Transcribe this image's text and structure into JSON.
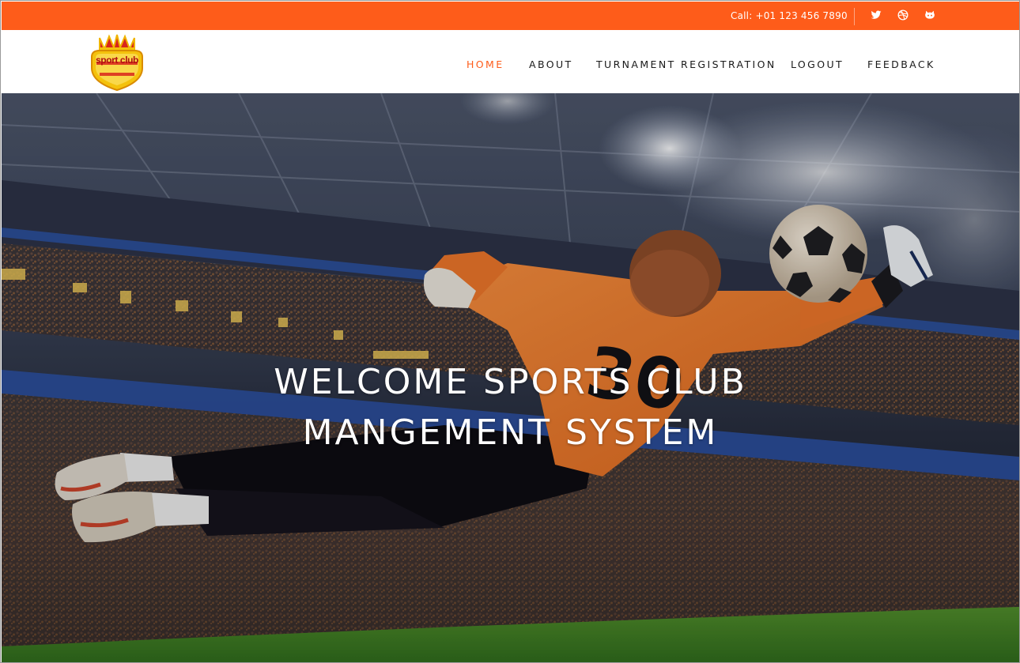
{
  "topbar": {
    "call_text": "Call: +01 123 456 7890",
    "background_color": "#fe5c1a",
    "social_icons": [
      "twitter-icon",
      "dribbble-icon",
      "github-icon"
    ]
  },
  "header": {
    "logo_text": "sport club",
    "nav": [
      {
        "label": "HOME",
        "active": true
      },
      {
        "label": "ABOUT",
        "active": false
      },
      {
        "label": "TURNAMENT REGISTRATION",
        "active": false
      },
      {
        "label": "LOGOUT",
        "active": false
      },
      {
        "label": "FEEDBACK",
        "active": false
      }
    ],
    "accent_color": "#fe5c1a"
  },
  "hero": {
    "title_line1": "WELCOME SPORTS CLUB",
    "title_line2": "MANGEMENT SYSTEM",
    "jersey_number": "30"
  }
}
